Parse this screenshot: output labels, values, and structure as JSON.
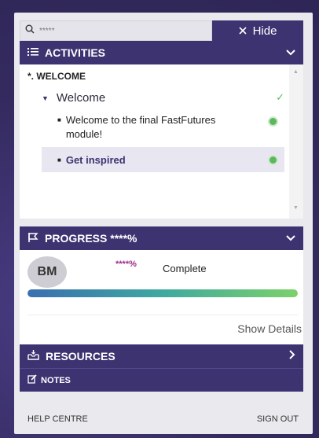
{
  "search": {
    "placeholder": "*****"
  },
  "hide_button": {
    "label": "Hide",
    "icon": "close-icon"
  },
  "activities": {
    "header": "ACTIVITIES",
    "group_title": "*. WELCOME",
    "section_label": "Welcome",
    "items": [
      {
        "label": "Welcome to the final FastFutures module!",
        "status": "complete"
      },
      {
        "label": "Get inspired",
        "status": "complete",
        "selected": true
      }
    ]
  },
  "progress": {
    "header": "PROGRESS ****%",
    "avatar_initials": "BM",
    "percent_text": "****%",
    "complete_label": "Complete",
    "fill_fraction": 1.0,
    "show_details": "Show Details"
  },
  "resources": {
    "header": "RESOURCES"
  },
  "notes": {
    "label": "NOTES"
  },
  "footer": {
    "help": "HELP CENTRE",
    "signout": "SIGN OUT"
  },
  "colors": {
    "brand": "#3d3371",
    "accent_green": "#5cb85c",
    "accent_magenta": "#9c2c8c"
  }
}
